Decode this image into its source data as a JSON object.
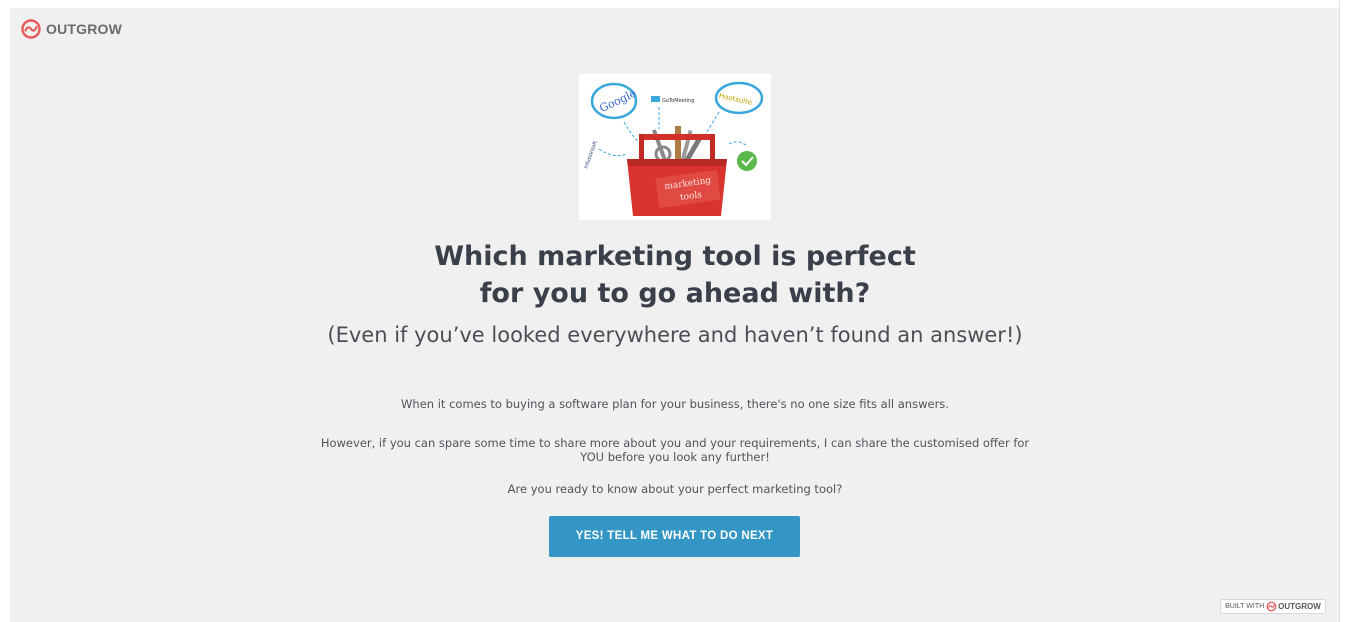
{
  "logo": {
    "text": "OUTGROW",
    "icon": "outgrow-logo-icon",
    "color": "#e8595a"
  },
  "hero": {
    "image_label_box_line1": "marketing",
    "image_label_box_line2": "tools",
    "image_label_google": "Google",
    "image_label_gotomeeting": "GoToMeeting",
    "image_label_hootsuite": "Hootsuite",
    "image_label_infusionsoft": "Infusionsoft"
  },
  "content": {
    "headline_line1": "Which marketing tool is perfect",
    "headline_line2": "for you to go ahead with?",
    "subheadline": "(Even if you’ve looked everywhere and haven’t found an answer!)",
    "paragraph1": "When it comes to buying a software plan for your business, there's no one size fits all answers.",
    "paragraph2": "However, if you can spare some time to share more about you and your requirements, I can share the customised offer for YOU before you look any further!",
    "paragraph3": "Are you ready to know about your perfect marketing tool?"
  },
  "cta": {
    "label": "YES! TELL ME WHAT TO DO NEXT",
    "color": "#3496c4"
  },
  "footer_badge": {
    "prefix": "BUILT WITH",
    "brand": "OUTGROW"
  },
  "colors": {
    "background": "#f0f0f0",
    "text_dark": "#3a4049",
    "accent": "#3496c4",
    "brand_red": "#e8595a"
  }
}
